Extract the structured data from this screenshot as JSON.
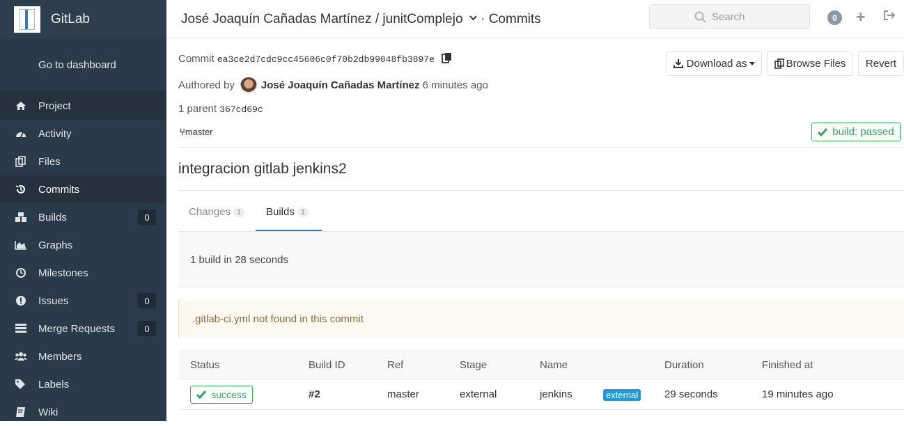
{
  "app": {
    "name": "GitLab"
  },
  "sidebar": {
    "dashboard": "Go to dashboard",
    "items": [
      {
        "label": "Project",
        "icon": "home-icon"
      },
      {
        "label": "Activity",
        "icon": "dashboard-icon"
      },
      {
        "label": "Files",
        "icon": "files-icon"
      },
      {
        "label": "Commits",
        "icon": "history-icon"
      },
      {
        "label": "Builds",
        "icon": "cubes-icon",
        "count": "0"
      },
      {
        "label": "Graphs",
        "icon": "area-chart-icon"
      },
      {
        "label": "Milestones",
        "icon": "clock-icon"
      },
      {
        "label": "Issues",
        "icon": "exclamation-circle-icon",
        "count": "0"
      },
      {
        "label": "Merge Requests",
        "icon": "list-icon",
        "count": "0"
      },
      {
        "label": "Members",
        "icon": "users-icon"
      },
      {
        "label": "Labels",
        "icon": "tags-icon"
      },
      {
        "label": "Wiki",
        "icon": "book-icon"
      }
    ]
  },
  "header": {
    "owner": "José Joaquín Cañadas Martínez",
    "sep": " / ",
    "project": "junitComplejo",
    "page": " · Commits",
    "search_placeholder": "Search",
    "notif_count": "0"
  },
  "commit": {
    "label": "Commit",
    "sha": "ea3ce2d7cdc9cc45606c0f70b2db99048fb3897e",
    "authored_by": "Authored by",
    "author": "José Joaquín Cañadas Martínez",
    "time": "6 minutes ago",
    "parent_prefix": "1 parent",
    "parent_sha": "367cd69c",
    "branch": "master",
    "build_status": "build: passed",
    "title": "integracion gitlab jenkins2"
  },
  "actions": {
    "download": "Download as",
    "browse": "Browse Files",
    "revert": "Revert"
  },
  "tabs": [
    {
      "label": "Changes",
      "count": "1"
    },
    {
      "label": "Builds",
      "count": "1"
    }
  ],
  "builds": {
    "summary": "1 build in 28 seconds",
    "warning": ".gitlab-ci.yml not found in this commit",
    "columns": [
      "Status",
      "Build ID",
      "Ref",
      "Stage",
      "Name",
      "Duration",
      "Finished at"
    ],
    "rows": [
      {
        "status": "success",
        "id": "#2",
        "ref": "master",
        "stage": "external",
        "name": "jenkins",
        "tag": "external",
        "duration": "29 seconds",
        "finished": "19 minutes ago"
      }
    ]
  },
  "colors": {
    "sidebar": "#2b3a48",
    "success": "#31a55a",
    "accent": "#3a78c0",
    "external_label": "#1f9ad6"
  }
}
